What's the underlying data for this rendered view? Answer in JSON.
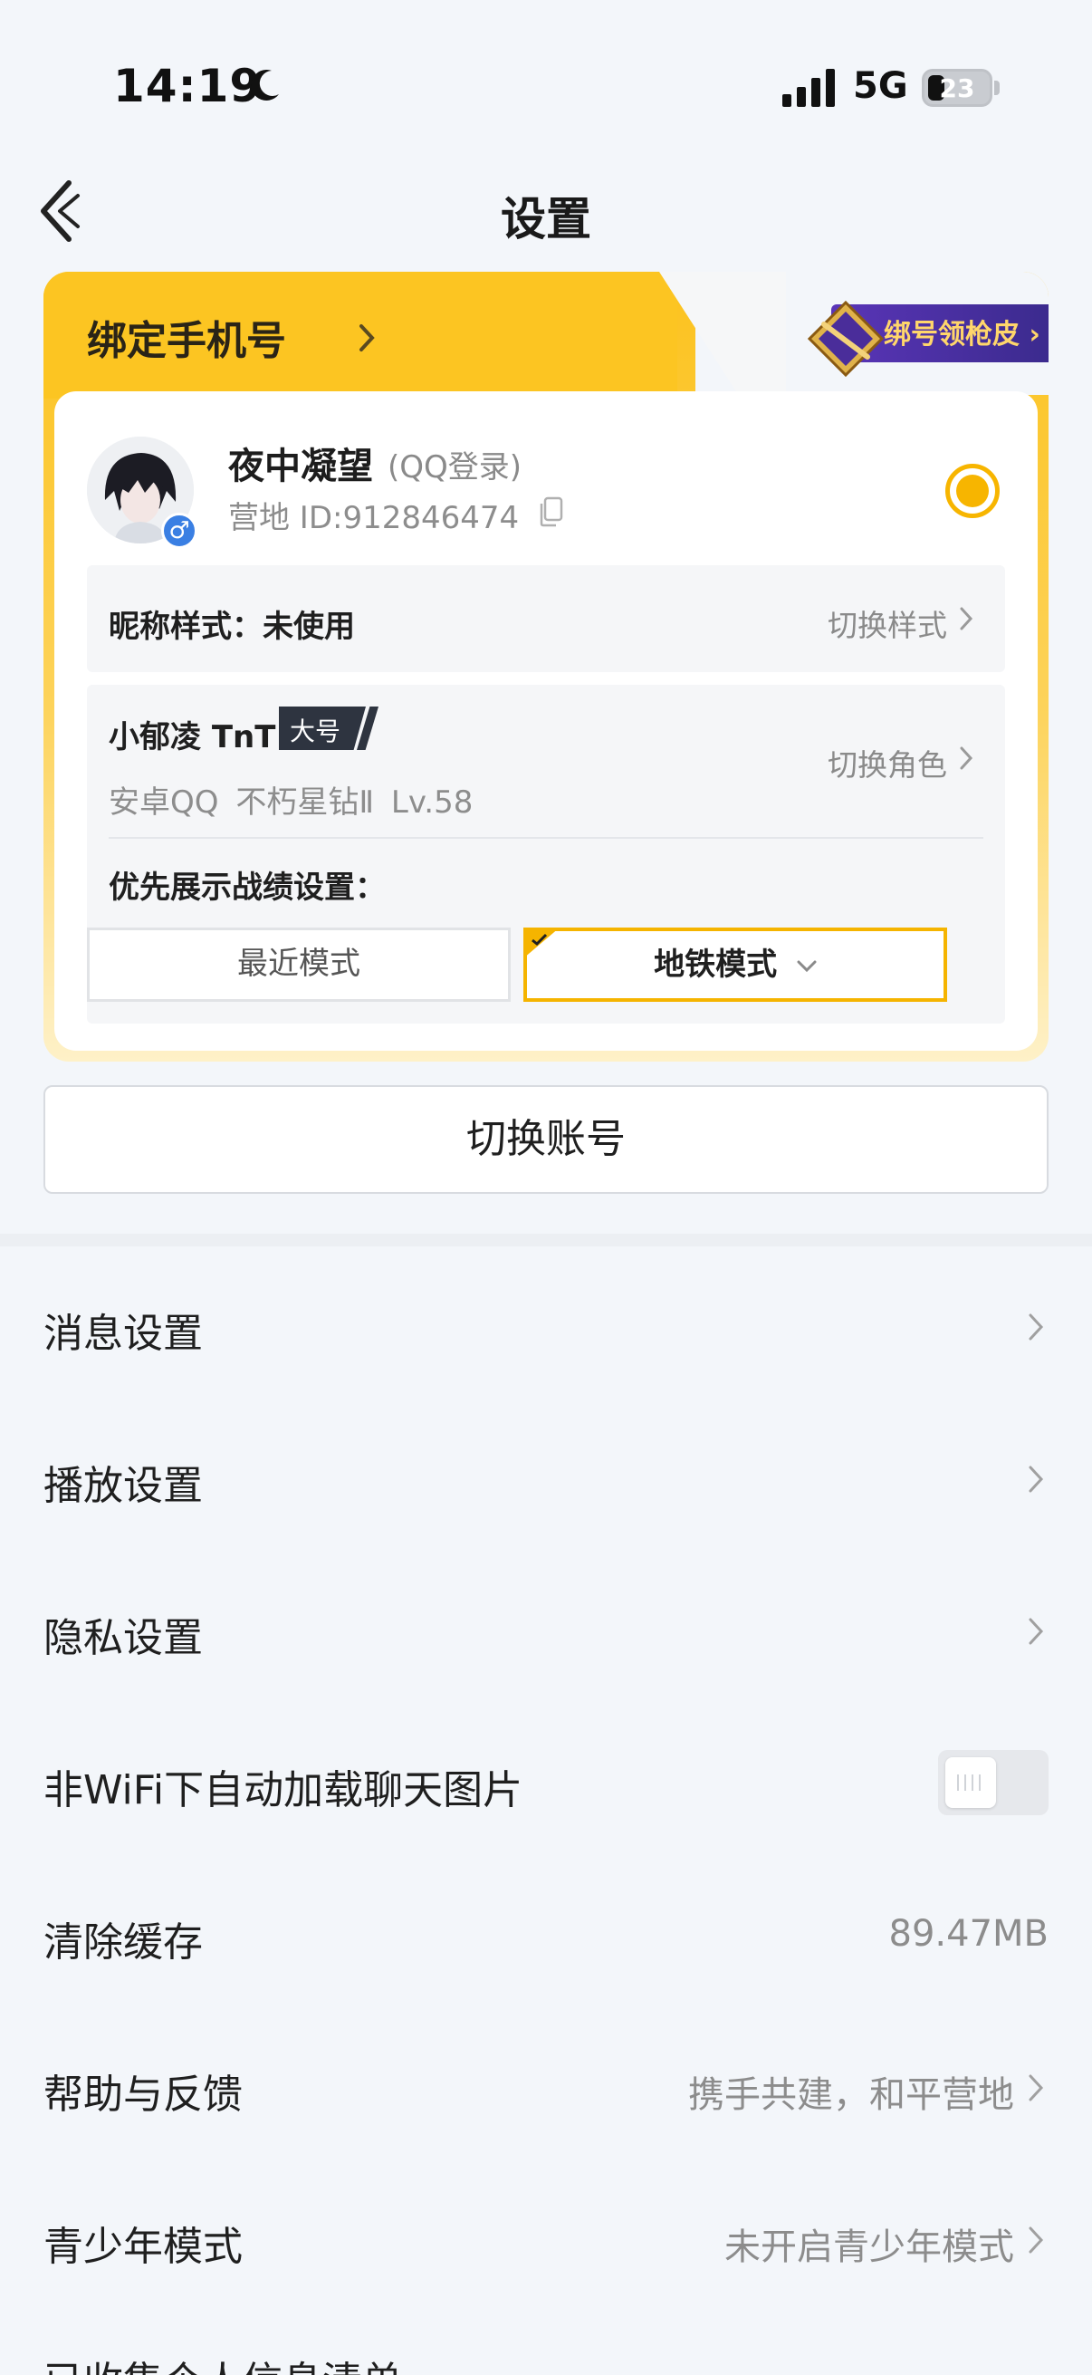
{
  "status_bar": {
    "time": "14:19",
    "network": "5G",
    "battery": "23"
  },
  "nav": {
    "title": "设置"
  },
  "account_card": {
    "bind_phone_label": "绑定手机号",
    "promo_label": "绑号领枪皮",
    "nickname": "夜中凝望",
    "login_type": "(QQ登录)",
    "camp_id": "营地 ID:912846474",
    "nickname_style": {
      "label": "昵称样式：未使用",
      "action": "切换样式"
    },
    "role": {
      "name": "小郁凌 TnT",
      "tag": "大号",
      "meta": "安卓QQ  不朽星钻Ⅱ  Lv.58",
      "action": "切换角色"
    },
    "priority_label": "优先展示战绩设置：",
    "modes": {
      "recent": "最近模式",
      "subway": "地铁模式"
    }
  },
  "switch_account_label": "切换账号",
  "settings": [
    {
      "label": "消息设置"
    },
    {
      "label": "播放设置"
    },
    {
      "label": "隐私设置"
    },
    {
      "label": "非WiFi下自动加载聊天图片"
    },
    {
      "label": "清除缓存",
      "value": "89.47MB"
    },
    {
      "label": "帮助与反馈",
      "value": "携手共建，和平营地"
    },
    {
      "label": "青少年模式",
      "value": "未开启青少年模式"
    },
    {
      "label": "已收集个人信息清单"
    }
  ],
  "colors": {
    "accent": "#f7b500",
    "card_gold": "#fcc21d",
    "promo_purple": "#5a35b8",
    "gender_blue": "#3a7fe3"
  }
}
